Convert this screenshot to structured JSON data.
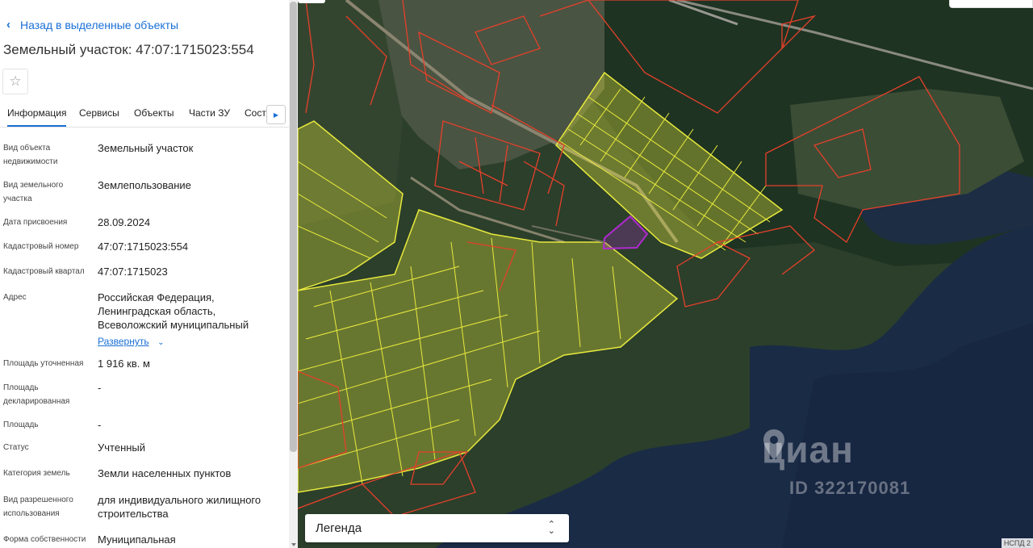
{
  "panel": {
    "back_label": "Назад в выделенные объекты",
    "title": "Земельный участок: 47:07:1715023:554",
    "tabs": [
      "Информация",
      "Сервисы",
      "Объекты",
      "Части ЗУ",
      "Состав"
    ],
    "rows": [
      {
        "label": "Вид объекта недвижимости",
        "value": "Земельный участок"
      },
      {
        "label": "Вид земельного участка",
        "value": "Землепользование"
      },
      {
        "label": "Дата присвоения",
        "value": "28.09.2024"
      },
      {
        "label": "Кадастровый номер",
        "value": "47:07:1715023:554"
      },
      {
        "label": "Кадастровый квартал",
        "value": "47:07:1715023"
      },
      {
        "label": "Адрес",
        "value": "Российская Федерация, Ленинградская область, Всеволожский муниципальный"
      },
      {
        "label": "Площадь уточненная",
        "value": "1 916 кв. м"
      },
      {
        "label": "Площадь декларированная",
        "value": "-"
      },
      {
        "label": "Площадь",
        "value": "-"
      },
      {
        "label": "Статус",
        "value": "Учтенный"
      },
      {
        "label": "Категория земель",
        "value": "Земли населенных пунктов"
      },
      {
        "label": "Вид разрешенного использования",
        "value": "для индивидуального жилищного строительства"
      },
      {
        "label": "Форма собственности",
        "value": "Муниципальная"
      }
    ],
    "expand_label": "Развернуть"
  },
  "map": {
    "legend_label": "Легенда",
    "watermark": "циан",
    "watermark_id": "ID 322170081",
    "badge": "НСПД 2"
  },
  "colors": {
    "accent": "#1a6fd6",
    "parcel_red": "#e5402b",
    "parcel_yellow": "#e8ea3c",
    "selected_parcel": "#b02ad0"
  }
}
